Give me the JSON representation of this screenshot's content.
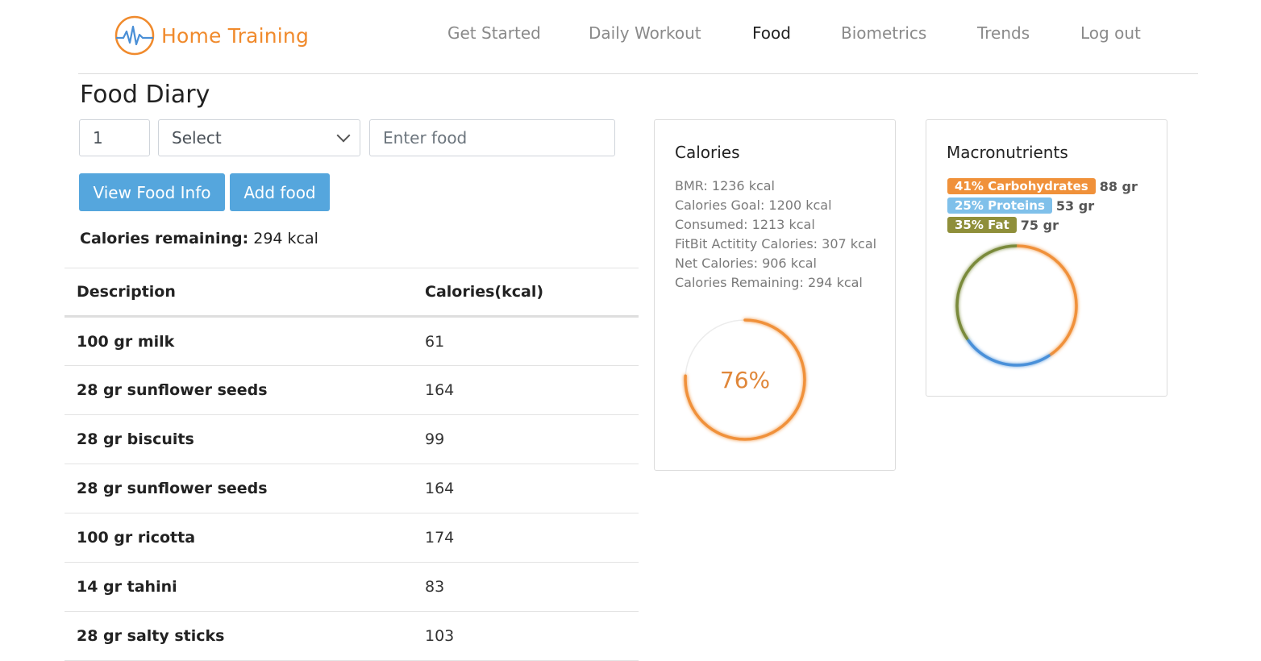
{
  "brand": {
    "name": "Home Training",
    "color": "#f08a2c",
    "logo_icon": "heartbeat-icon"
  },
  "nav": [
    {
      "label": "Get Started",
      "active": false
    },
    {
      "label": "Daily Workout",
      "active": false
    },
    {
      "label": "Food",
      "active": true
    },
    {
      "label": "Biometrics",
      "active": false
    },
    {
      "label": "Trends",
      "active": false
    },
    {
      "label": "Log out",
      "active": false
    }
  ],
  "page": {
    "title": "Food Diary"
  },
  "form": {
    "quantity": "1",
    "unit_selected": "Select",
    "food_placeholder": "Enter food",
    "view_button": "View Food Info",
    "add_button": "Add food"
  },
  "remaining": {
    "label": "Calories remaining:",
    "value": "294 kcal"
  },
  "table": {
    "headers": [
      "Description",
      "Calories(kcal)"
    ],
    "rows": [
      {
        "description": "100 gr milk",
        "calories": "61"
      },
      {
        "description": "28 gr sunflower seeds",
        "calories": "164"
      },
      {
        "description": "28 gr biscuits",
        "calories": "99"
      },
      {
        "description": "28 gr sunflower seeds",
        "calories": "164"
      },
      {
        "description": "100 gr ricotta",
        "calories": "174"
      },
      {
        "description": "14 gr tahini",
        "calories": "83"
      },
      {
        "description": "28 gr salty sticks",
        "calories": "103"
      }
    ]
  },
  "calories_card": {
    "title": "Calories",
    "stats": [
      "BMR: 1236 kcal",
      "Calories Goal: 1200 kcal",
      "Consumed: 1213 kcal",
      "FitBit Actitity Calories: 307 kcal",
      "Net Calories: 906 kcal",
      "Calories Remaining: 294 kcal"
    ],
    "percent_label": "76%",
    "progress": 0.76,
    "ring_color": "#f0913a"
  },
  "macro_card": {
    "title": "Macronutrients",
    "items": [
      {
        "badge": "41% Carbohydrates",
        "amount": "88 gr",
        "fraction": 0.41,
        "color": "#f0913a"
      },
      {
        "badge": "25% Proteins",
        "amount": "53 gr",
        "fraction": 0.25,
        "color": "#7fc0ea"
      },
      {
        "badge": "35% Fat",
        "amount": "75 gr",
        "fraction": 0.35,
        "color": "#8f8f3a"
      }
    ],
    "ring_colors": [
      "#f0913a",
      "#4a90d9",
      "#7a8a3a"
    ]
  }
}
